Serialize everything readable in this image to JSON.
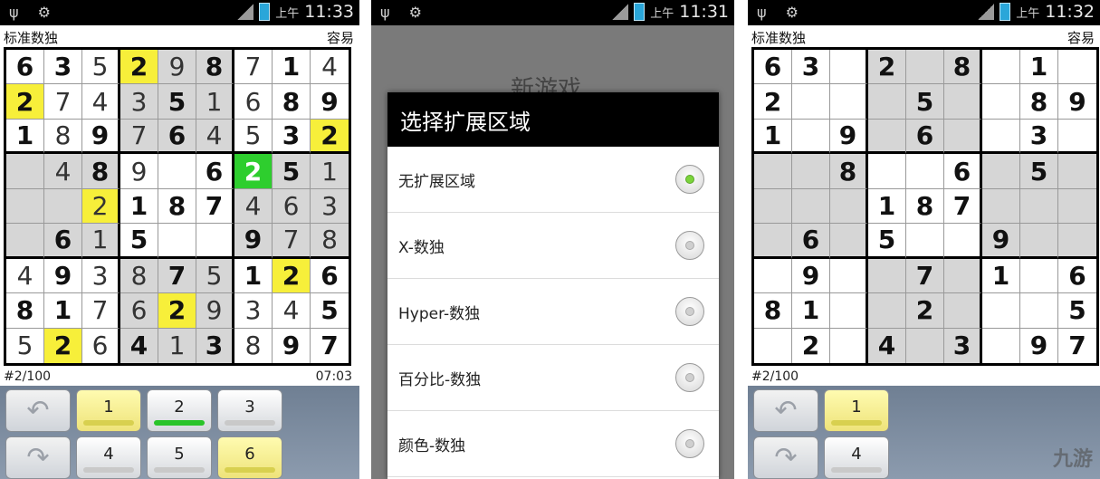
{
  "status": {
    "ampm": "上午",
    "times": [
      "11:33",
      "11:31",
      "11:32"
    ]
  },
  "game": {
    "mode": "标准数独",
    "difficulty": "容易",
    "puzzle_number": "#2/100",
    "timer": "07:03"
  },
  "board1": [
    [
      "6",
      "3",
      "5",
      "2",
      "9",
      "8",
      "7",
      "1",
      "4"
    ],
    [
      "2",
      "7",
      "4",
      "3",
      "5",
      "1",
      "6",
      "8",
      "9"
    ],
    [
      "1",
      "8",
      "9",
      "7",
      "6",
      "4",
      "5",
      "3",
      "2"
    ],
    [
      "",
      "4",
      "8",
      "9",
      "",
      "6",
      "2",
      "5",
      "1"
    ],
    [
      "",
      "",
      "2",
      "1",
      "8",
      "7",
      "4",
      "6",
      "3"
    ],
    [
      "",
      "6",
      "1",
      "5",
      "",
      "",
      "9",
      "7",
      "8"
    ],
    [
      "4",
      "9",
      "3",
      "8",
      "7",
      "5",
      "1",
      "2",
      "6"
    ],
    [
      "8",
      "1",
      "7",
      "6",
      "2",
      "9",
      "3",
      "4",
      "5"
    ],
    [
      "5",
      "2",
      "6",
      "4",
      "1",
      "3",
      "8",
      "9",
      "7"
    ]
  ],
  "board3": [
    [
      "6",
      "3",
      "",
      "2",
      "",
      "8",
      "",
      "1",
      ""
    ],
    [
      "2",
      "",
      "",
      "",
      "5",
      "",
      "",
      "8",
      "9"
    ],
    [
      "1",
      "",
      "9",
      "",
      "6",
      "",
      "",
      "3",
      ""
    ],
    [
      "",
      "",
      "8",
      "",
      "",
      "6",
      "",
      "5",
      ""
    ],
    [
      "",
      "",
      "",
      "1",
      "8",
      "7",
      "",
      "",
      ""
    ],
    [
      "",
      "6",
      "",
      "5",
      "",
      "",
      "9",
      "",
      ""
    ],
    [
      "",
      "9",
      "",
      "",
      "7",
      "",
      "1",
      "",
      "6"
    ],
    [
      "8",
      "1",
      "",
      "",
      "2",
      "",
      "",
      "",
      "5"
    ],
    [
      "",
      "2",
      "",
      "4",
      "",
      "3",
      "",
      "9",
      "7"
    ]
  ],
  "keypad": {
    "row1": [
      "1",
      "2",
      "3"
    ],
    "row2": [
      "4",
      "5",
      "6"
    ],
    "partial_row1": [
      "1"
    ],
    "partial_row2": [
      "4"
    ]
  },
  "dialog": {
    "background_title": "新游戏",
    "title": "选择扩展区域",
    "options": [
      "无扩展区域",
      "X-数独",
      "Hyper-数独",
      "百分比-数独",
      "颜色-数独"
    ]
  },
  "watermark": "九游"
}
